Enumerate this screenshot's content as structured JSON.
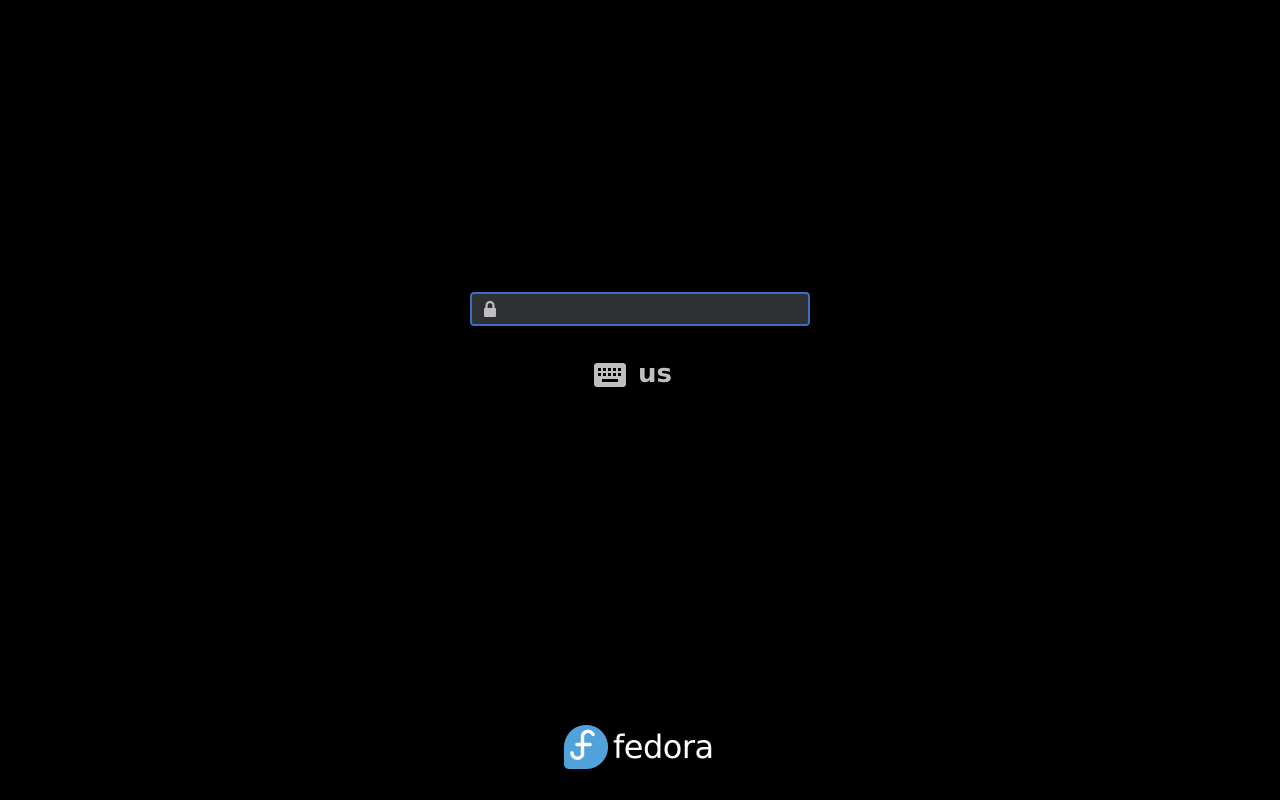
{
  "lock_screen": {
    "password_field": {
      "value": "",
      "placeholder": ""
    },
    "keyboard_layout": {
      "label": "us"
    },
    "branding": {
      "logo_text": "fedora"
    }
  },
  "colors": {
    "background": "#000000",
    "field_background": "#2e3033",
    "field_border_focus": "#3c6fc4",
    "icon_grey": "#bfbfbf",
    "fedora_blue": "#51a2da"
  },
  "icons": {
    "lock": "lock-icon",
    "keyboard": "keyboard-icon",
    "logo": "fedora-logo-icon"
  }
}
